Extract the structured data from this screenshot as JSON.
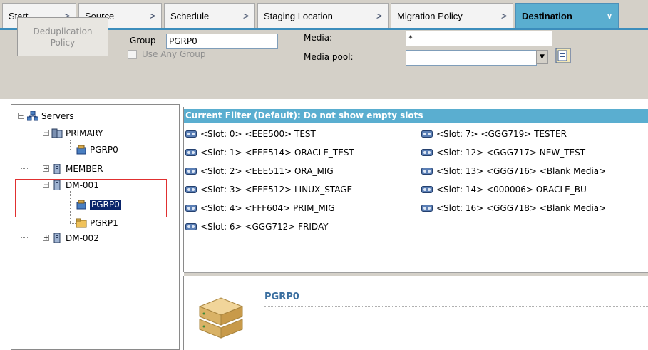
{
  "tabs": [
    {
      "label": "Start"
    },
    {
      "label": "Source"
    },
    {
      "label": "Schedule"
    },
    {
      "label": "Staging Location"
    },
    {
      "label": "Migration Policy"
    },
    {
      "label": "Destination"
    }
  ],
  "options": {
    "dedup_button": "Deduplication\nPolicy",
    "group_label": "Group",
    "group_value": "PGRP0",
    "use_any_group_label": "Use Any Group",
    "media_label": "Media:",
    "media_value": "*",
    "media_pool_label": "Media pool:",
    "media_pool_value": ""
  },
  "tree": {
    "root": "Servers",
    "nodes": [
      {
        "label": "PRIMARY"
      },
      {
        "label": "PGRP0"
      },
      {
        "label": "MEMBER"
      },
      {
        "label": "DM-001"
      },
      {
        "label": "PGRP0"
      },
      {
        "label": "PGRP1"
      },
      {
        "label": "DM-002"
      }
    ]
  },
  "filter": "Current Filter (Default):  Do not show empty slots",
  "slots": {
    "col1": [
      "<Slot:  0> <EEE500> TEST",
      "<Slot:  1> <EEE514> ORACLE_TEST",
      "<Slot:  2> <EEE511> ORA_MIG",
      "<Slot:  3> <EEE512> LINUX_STAGE",
      "<Slot:  4> <FFF604> PRIM_MIG",
      "<Slot:  6> <GGG712> FRIDAY"
    ],
    "col2": [
      "<Slot:  7> <GGG719> TESTER",
      "<Slot: 12> <GGG717> NEW_TEST",
      "<Slot: 13> <GGG716> <Blank Media>",
      "<Slot: 14> <000006> ORACLE_BU",
      "<Slot: 16> <GGG718> <Blank Media>"
    ]
  },
  "details": {
    "title": "PGRP0"
  },
  "colors": {
    "accent": "#5aaed0",
    "selection": "#0a246a",
    "highlight": "#e03030"
  }
}
